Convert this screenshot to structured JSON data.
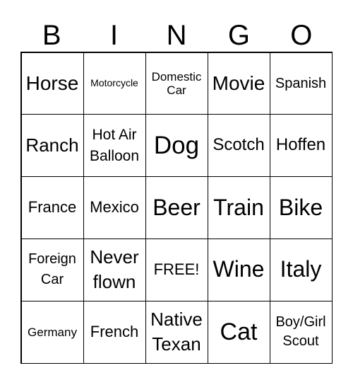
{
  "header": [
    "B",
    "I",
    "N",
    "G",
    "O"
  ],
  "cells": [
    "Horse",
    "Motorcycle",
    "Domestic Car",
    "Movie",
    "Spanish",
    "Ranch",
    "Hot Air Balloon",
    "Dog",
    "Scotch",
    "Hoffen",
    "France",
    "Mexico",
    "Beer",
    "Train",
    "Bike",
    "Foreign Car",
    "Never flown",
    "FREE!",
    "Wine",
    "Italy",
    "Germany",
    "French",
    "Native Texan",
    "Cat",
    "Boy/Girl Scout"
  ]
}
